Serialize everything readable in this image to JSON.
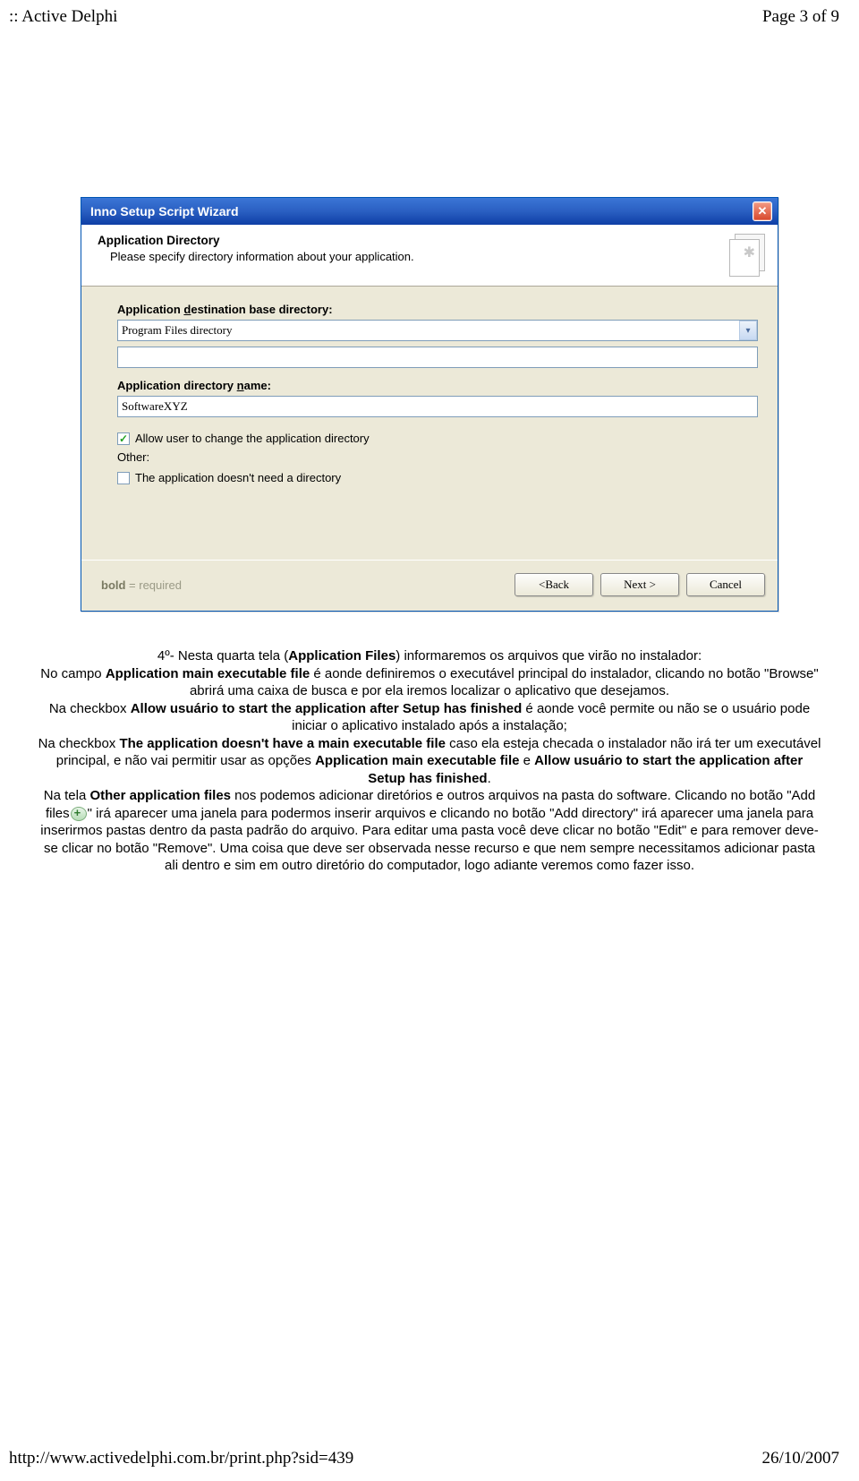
{
  "header": {
    "left": ":: Active Delphi",
    "right": "Page 3 of 9"
  },
  "wizard": {
    "title": "Inno Setup Script Wizard",
    "panel": {
      "heading": "Application Directory",
      "sub": "Please specify directory information about your application."
    },
    "labels": {
      "dest_pre": "Application ",
      "dest_u": "d",
      "dest_post": "estination base directory:",
      "name_pre": "Application directory ",
      "name_u": "n",
      "name_post": "ame:",
      "other": "Other:"
    },
    "fields": {
      "dest_value": "Program Files directory",
      "sub_value": "",
      "name_value": "SoftwareXYZ"
    },
    "cb": {
      "allow_pre": "Allow user to ",
      "allow_u": "c",
      "allow_post": "hange the application directory",
      "nodir": "The application doesn't need a directory"
    },
    "footer": {
      "bold": "bold",
      "req": " = required",
      "back_pre": "< ",
      "back_u": "B",
      "back_post": "ack",
      "next_u": "N",
      "next_post": "ext >",
      "cancel": "Cancel"
    }
  },
  "para": {
    "p1a": "4º- Nesta quarta tela (",
    "p1b": "Application Files",
    "p1c": ") informaremos os arquivos que virão no instalador:",
    "p2a": "No campo ",
    "p2b": "Application main executable file",
    "p2c": " é aonde definiremos o executável principal do instalador, clicando no botão \"Browse\" abrirá uma caixa de busca e por ela iremos localizar o aplicativo que desejamos.",
    "p3a": "Na checkbox ",
    "p3b": "Allow usuário to start the application after Setup has finished",
    "p3c": " é aonde você permite ou não se o usuário pode iniciar o aplicativo instalado após a instalação;",
    "p4a": "Na checkbox ",
    "p4b": "The application doesn't have a main executable file",
    "p4c": " caso ela esteja checada o instalador não irá ter um executável principal, e não vai permitir usar as opções ",
    "p4d": "Application main executable file",
    "p4e": " e ",
    "p4f": "Allow usuário to start the application after Setup has finished",
    "p4g": ".",
    "p5a": "Na tela ",
    "p5b": "Other application files",
    "p5c": " nos podemos adicionar diretórios e outros arquivos na pasta do software. Clicando no botão \"Add files",
    "p5d": "\" irá aparecer uma janela para podermos inserir arquivos e clicando no botão \"Add directory\" irá aparecer uma janela para inserirmos pastas dentro da pasta padrão do arquivo. Para editar uma pasta você deve clicar no botão \"Edit\" e para remover deve-se clicar no botão \"Remove\". Uma coisa que deve ser observada nesse recurso e que nem sempre necessitamos adicionar pasta ali dentro e sim em outro diretório do computador, logo adiante veremos como fazer isso."
  },
  "footer": {
    "url": "http://www.activedelphi.com.br/print.php?sid=439",
    "date": "26/10/2007"
  }
}
